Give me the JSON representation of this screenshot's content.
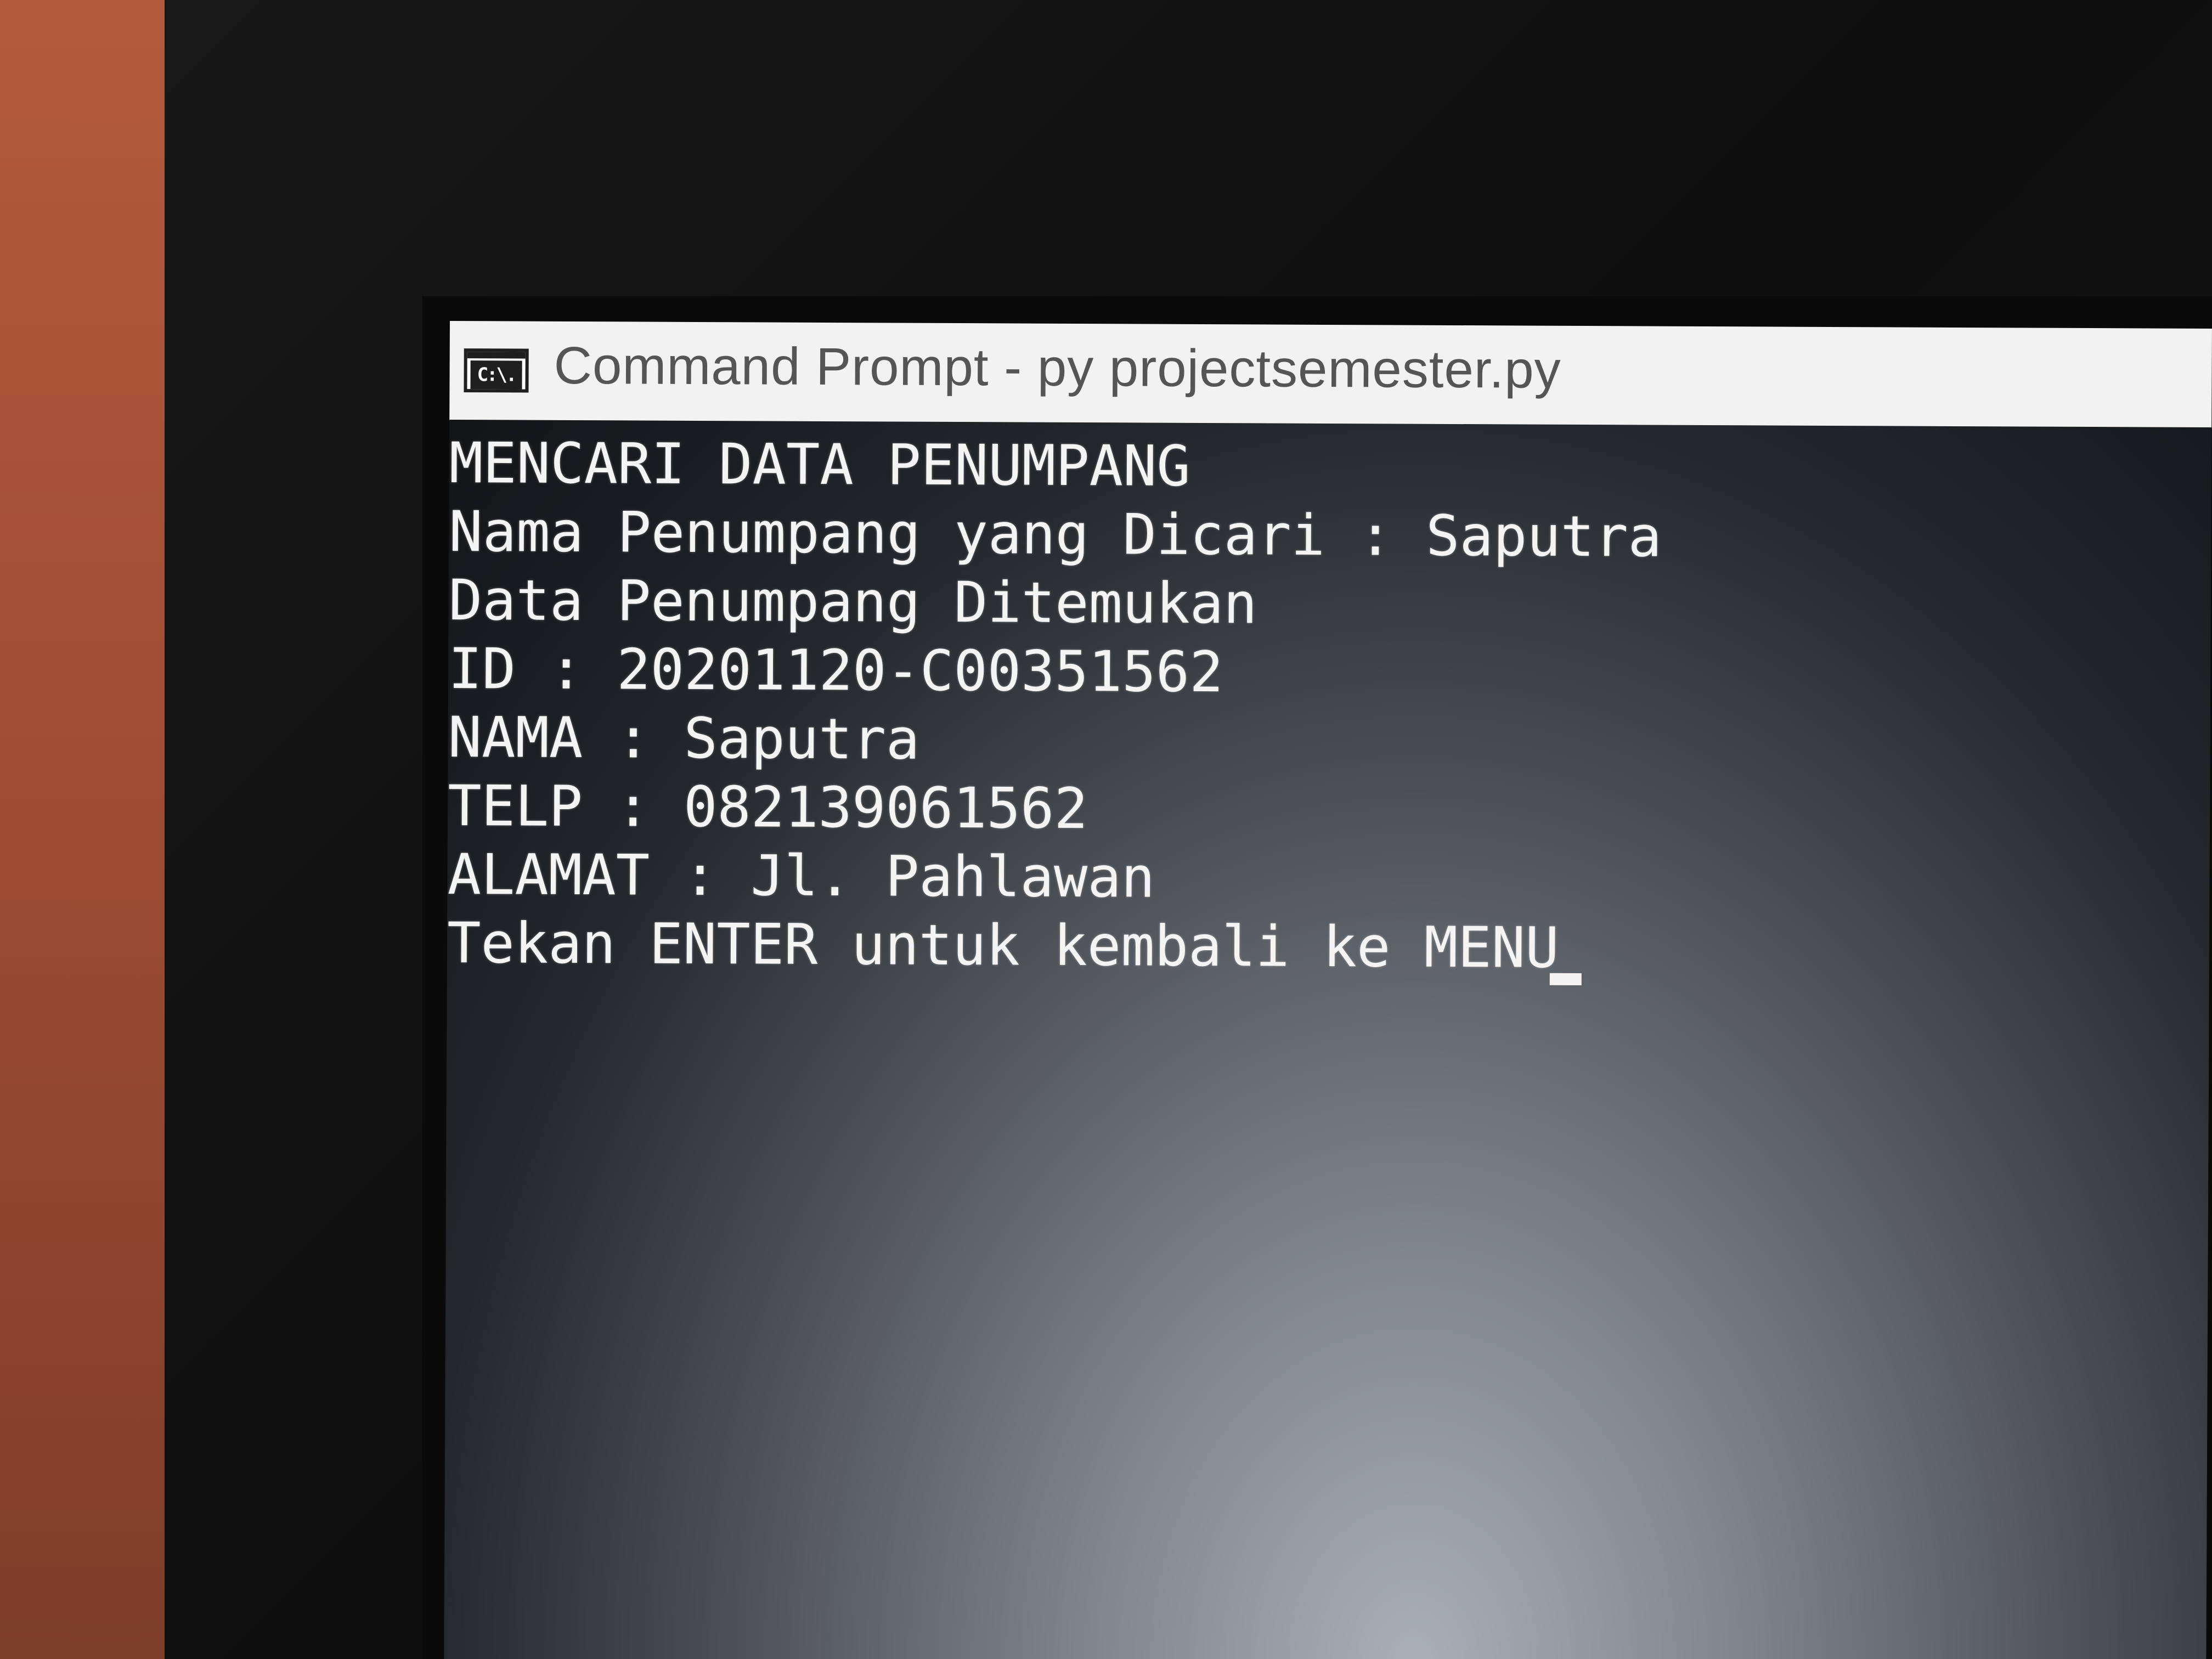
{
  "window": {
    "title": "Command Prompt - py  projectsemester.py",
    "icon": "command-prompt-icon",
    "icon_text": "C:\\."
  },
  "console": {
    "lines": [
      "MENCARI DATA PENUMPANG",
      "Nama Penumpang yang Dicari : Saputra",
      "Data Penumpang Ditemukan",
      "ID : 20201120-C00351562",
      "NAMA : Saputra",
      "TELP : 082139061562",
      "ALAMAT : Jl. Pahlawan",
      "Tekan ENTER untuk kembali ke MENU"
    ]
  }
}
